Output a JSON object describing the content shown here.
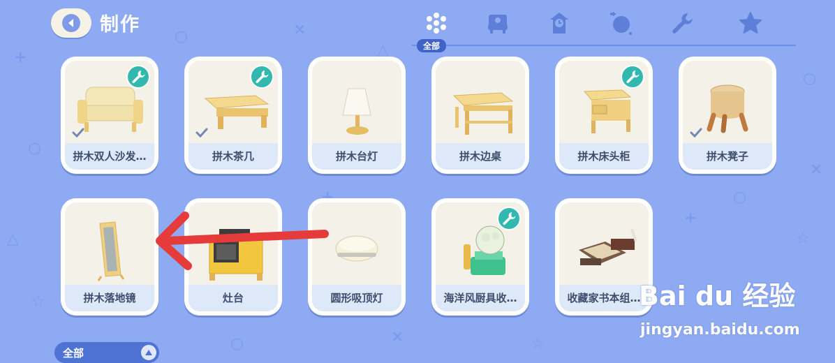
{
  "header": {
    "title": "制作"
  },
  "tabs": [
    {
      "name": "all-icon",
      "label": "全部",
      "active": true
    },
    {
      "name": "furniture-icon"
    },
    {
      "name": "clock-icon"
    },
    {
      "name": "ball-icon"
    },
    {
      "name": "wrench-icon"
    },
    {
      "name": "star-icon"
    }
  ],
  "recipes": [
    {
      "label": "拼木双人沙发…",
      "customizable": true,
      "crafted": true
    },
    {
      "label": "拼木茶几",
      "customizable": true,
      "crafted": true
    },
    {
      "label": "拼木台灯",
      "customizable": false,
      "crafted": false
    },
    {
      "label": "拼木边桌",
      "customizable": false,
      "crafted": false
    },
    {
      "label": "拼木床头柜",
      "customizable": true,
      "crafted": false
    },
    {
      "label": "拼木凳子",
      "customizable": false,
      "crafted": true
    },
    {
      "label": "拼木落地镜",
      "customizable": false,
      "crafted": false
    },
    {
      "label": "灶台",
      "customizable": false,
      "crafted": false
    },
    {
      "label": "圆形吸顶灯",
      "customizable": false,
      "crafted": false
    },
    {
      "label": "海洋风厨具收…",
      "customizable": true,
      "crafted": false
    },
    {
      "label": "收藏家书本组…",
      "customizable": false,
      "crafted": false
    }
  ],
  "filter": {
    "label": "全部"
  },
  "watermark": {
    "brand": "Bai du 经验",
    "url": "jingyan.baidu.com"
  },
  "colors": {
    "background": "#8eaaf3",
    "accent": "#3f63c9",
    "wrench_badge": "#33b8b0",
    "arrow": "#e53b3b"
  }
}
